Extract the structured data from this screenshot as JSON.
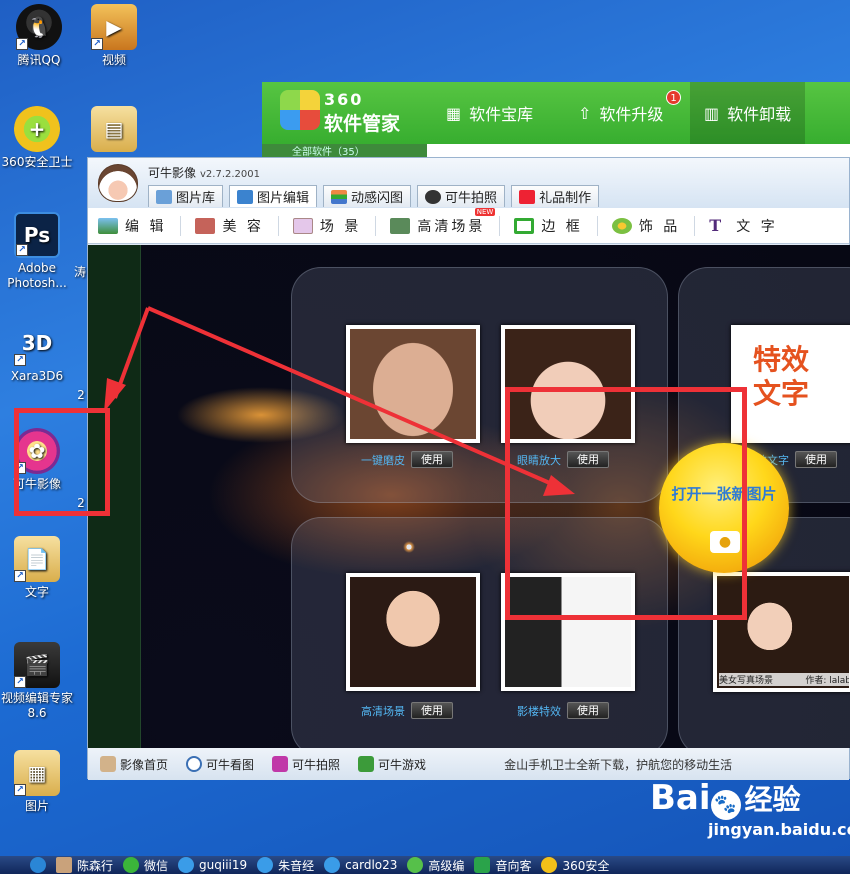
{
  "desktop": {
    "icons": [
      {
        "label": "腾讯QQ",
        "icon": "qq-penguin-icon"
      },
      {
        "label": "视频",
        "icon": "video-folder-icon"
      },
      {
        "label": "360安全卫士",
        "icon": "360-safe-icon"
      },
      {
        "label": "",
        "icon": "file-folder-icon"
      },
      {
        "label": "Adobe Photosh...",
        "icon": "photoshop-icon"
      },
      {
        "label": "Xara3D6",
        "icon": "xara3d-icon"
      },
      {
        "label": "可牛影像",
        "icon": "keniu-icon"
      },
      {
        "label": "文字",
        "icon": "folder-icon"
      },
      {
        "label": "视频编辑专家 8.6",
        "icon": "video-editor-icon"
      },
      {
        "label": "图片",
        "icon": "folder-icon"
      }
    ],
    "partial_labels": [
      "涛",
      "2",
      "2",
      "2"
    ]
  },
  "app360": {
    "brand_top": "360",
    "brand_bottom": "软件管家",
    "tabs": [
      "软件宝库",
      "软件升级",
      "软件卸载"
    ],
    "upgrade_badge": "1",
    "sidebar_hint": "全部软件（35）"
  },
  "keniu": {
    "title": "可牛影像",
    "version": "v2.7.2.2001",
    "main_tabs": [
      "图片库",
      "图片编辑",
      "动感闪图",
      "可牛拍照",
      "礼品制作"
    ],
    "sub_tools": [
      "编 辑",
      "美 容",
      "场 景",
      "高清场景",
      "边 框",
      "饰 品",
      "文 字"
    ],
    "new_tag": "NEW",
    "features": [
      {
        "label": "一键磨皮",
        "button": "使用"
      },
      {
        "label": "眼睛放大",
        "button": "使用"
      },
      {
        "label": "特效文字",
        "button": "使用"
      },
      {
        "label": "高清场景",
        "button": "使用"
      },
      {
        "label": "影楼特效",
        "button": "使用"
      }
    ],
    "texteffect_art": "特效文字",
    "photo_caption_left": "美女写真场景",
    "photo_caption_right": "作者: lalab",
    "open_button": "打开一张新图片",
    "statusbar": [
      "影像首页",
      "可牛看图",
      "可牛拍照",
      "可牛游戏"
    ],
    "ad_text": "金山手机卫士全新下载，护航您的移动生活"
  },
  "annotation_color": "#ee3137",
  "taskbar": [
    {
      "label": "",
      "icon": "k-icon"
    },
    {
      "label": "陈森行",
      "icon": "avatar-icon"
    },
    {
      "label": "微信",
      "icon": "wechat-icon"
    },
    {
      "label": "guqiii19",
      "icon": "qq-chat-icon"
    },
    {
      "label": "朱音经",
      "icon": "qq-chat-icon"
    },
    {
      "label": "cardlo23",
      "icon": "qq-chat-icon"
    },
    {
      "label": "高级编",
      "icon": "editor-icon"
    },
    {
      "label": "音向客",
      "icon": "app-icon"
    },
    {
      "label": "360安全",
      "icon": "360-icon"
    }
  ],
  "watermark": {
    "brand": "Bai",
    "brand_suffix": "经验",
    "url": "jingyan.baidu.com"
  }
}
